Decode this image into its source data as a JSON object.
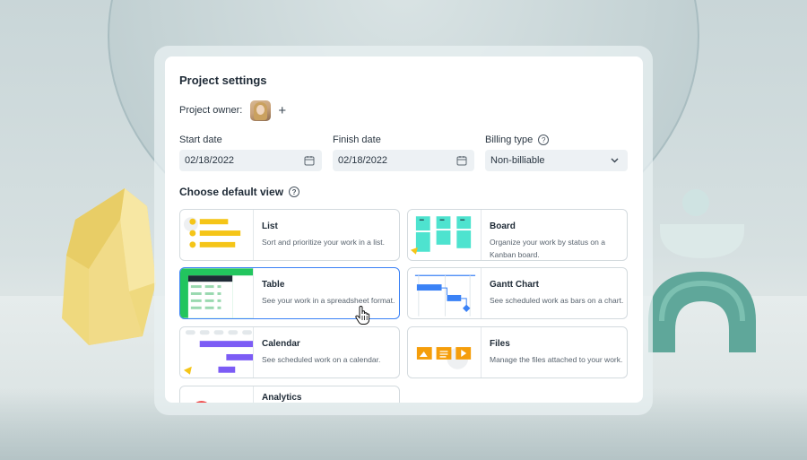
{
  "panel": {
    "title": "Project settings",
    "owner_label": "Project owner:",
    "start_date": {
      "label": "Start date",
      "value": "02/18/2022"
    },
    "finish_date": {
      "label": "Finish date",
      "value": "02/18/2022"
    },
    "billing_type": {
      "label": "Billing type",
      "value": "Non-billiable"
    },
    "default_view_title": "Choose default view"
  },
  "views": [
    {
      "title": "List",
      "description": "Sort and prioritize your work in a list."
    },
    {
      "title": "Board",
      "description": "Organize your work by status on a Kanban board."
    },
    {
      "title": "Table",
      "description": "See your work in a spreadsheet format.",
      "selected": true
    },
    {
      "title": "Gantt Chart",
      "description": "See scheduled work as bars on a chart."
    },
    {
      "title": "Calendar",
      "description": "See scheduled work on a calendar."
    },
    {
      "title": "Files",
      "description": "Manage the files attached to your work."
    },
    {
      "title": "Analytics",
      "description": ""
    }
  ],
  "colors": {
    "accent_blue": "#3b82f6",
    "list_yellow": "#f5c518",
    "board_teal": "#4ee3cf",
    "table_green": "#22c55e",
    "calendar_purple": "#7c5cf5",
    "files_orange": "#f59e0b"
  },
  "icons": [
    "avatar",
    "plus-icon",
    "calendar-icon",
    "chevron-down-icon",
    "help-icon",
    "hand-cursor-icon"
  ]
}
